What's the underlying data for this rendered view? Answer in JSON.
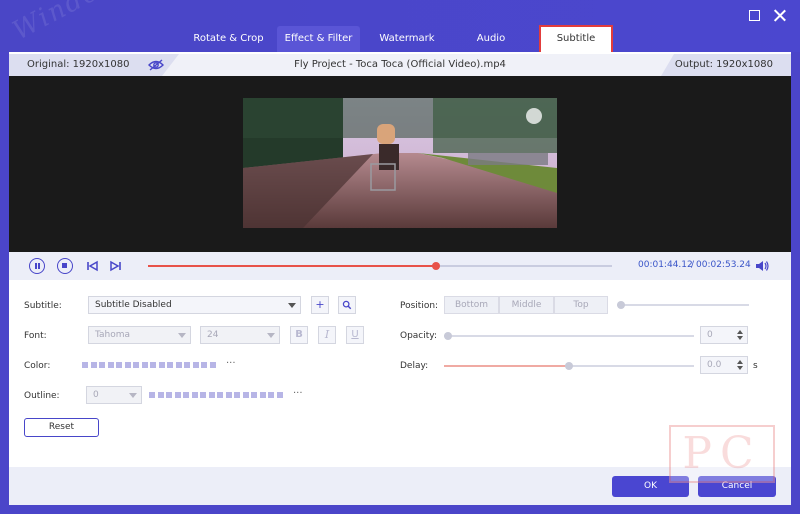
{
  "tabs": [
    {
      "label": "Rotate & Crop"
    },
    {
      "label": "Effect & Filter"
    },
    {
      "label": "Watermark"
    },
    {
      "label": "Audio"
    },
    {
      "label": "Subtitle"
    }
  ],
  "watermark_text": "WindowsPC",
  "info": {
    "original": "Original: 1920x1080",
    "file_name": "Fly Project - Toca Toca (Official Video).mp4",
    "output": "Output: 1920x1080"
  },
  "player": {
    "progress_fraction": 0.62,
    "current_time": "00:01:44.12",
    "separator": "/",
    "total_time": "00:02:53.24"
  },
  "subtitle": {
    "label": "Subtitle:",
    "value": "Subtitle Disabled",
    "add_symbol": "+"
  },
  "font": {
    "label": "Font:",
    "family": "Tahoma",
    "size": "24",
    "bold": "B",
    "italic": "I",
    "underline": "U"
  },
  "color": {
    "label": "Color:",
    "ellipsis": "···"
  },
  "outline": {
    "label": "Outline:",
    "value": "0",
    "ellipsis": "···"
  },
  "position": {
    "label": "Position:",
    "options": [
      "Bottom",
      "Middle",
      "Top"
    ]
  },
  "opacity": {
    "label": "Opacity:",
    "value": "0"
  },
  "delay": {
    "label": "Delay:",
    "value": "0.0",
    "unit": "s",
    "fraction": 0.5
  },
  "reset_label": "Reset",
  "ok_label": "OK",
  "cancel_label": "Cancel",
  "logo_text": "PC",
  "colors": {
    "accent": "#4846c9",
    "seek": "#e8524a",
    "highlight": "#e23c3c"
  }
}
